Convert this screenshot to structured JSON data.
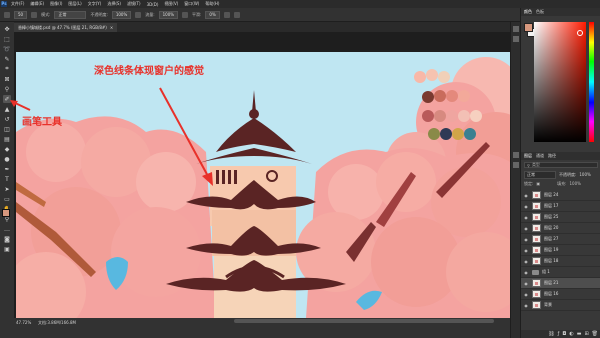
{
  "menubar": {
    "logo": "Ps",
    "items": [
      "文件(F)",
      "编辑(E)",
      "图像(I)",
      "图层(L)",
      "文字(Y)",
      "选择(S)",
      "滤镜(T)",
      "3D(D)",
      "视图(V)",
      "窗口(W)",
      "帮助(H)"
    ]
  },
  "options": {
    "brush_size": "50",
    "mode_label": "模式:",
    "mode_value": "正常",
    "opacity_label": "不透明度:",
    "opacity_value": "100%",
    "flow_label": "流量:",
    "flow_value": "100%",
    "smooth_label": "平滑:",
    "smooth_value": "0%"
  },
  "document": {
    "tab_title": "香樟小镇城楼.psd @ 47.7% (图层 21, RGB/8#)",
    "close_glyph": "×",
    "zoom": "47.72%",
    "status_info": "文档:3.86M/166.8M"
  },
  "annotations": {
    "canvas_note": "深色线条体现窗户的感觉",
    "tool_note": "画笔工具"
  },
  "color_panel": {
    "tabs": [
      "颜色",
      "色板"
    ],
    "foreground": "#d7987e",
    "background": "#f2f2f2"
  },
  "layers_panel": {
    "tabs": [
      "图层",
      "通道",
      "路径"
    ],
    "search_placeholder": "类型",
    "blend_mode": "正常",
    "opacity_label": "不透明度:",
    "opacity_value": "100%",
    "lock_label": "锁定:",
    "fill_label": "填充:",
    "fill_value": "100%",
    "layers": [
      {
        "name": "图层 24",
        "selected": false,
        "type": "layer"
      },
      {
        "name": "图层 17",
        "selected": false,
        "type": "layer"
      },
      {
        "name": "图层 25",
        "selected": false,
        "type": "layer"
      },
      {
        "name": "图层 20",
        "selected": false,
        "type": "layer"
      },
      {
        "name": "图层 27",
        "selected": false,
        "type": "layer"
      },
      {
        "name": "图层 19",
        "selected": false,
        "type": "layer"
      },
      {
        "name": "图层 18",
        "selected": false,
        "type": "layer"
      },
      {
        "name": "组 1",
        "selected": false,
        "type": "group"
      },
      {
        "name": "图层 21",
        "selected": true,
        "type": "layer"
      },
      {
        "name": "图层 16",
        "selected": false,
        "type": "layer"
      },
      {
        "name": "背景",
        "selected": false,
        "type": "layer"
      }
    ]
  },
  "colors": {
    "annotation": "#e8312a",
    "sky": "#bfe6f2",
    "blossom": "#f4a3a0",
    "roof_dark": "#5a2424"
  }
}
